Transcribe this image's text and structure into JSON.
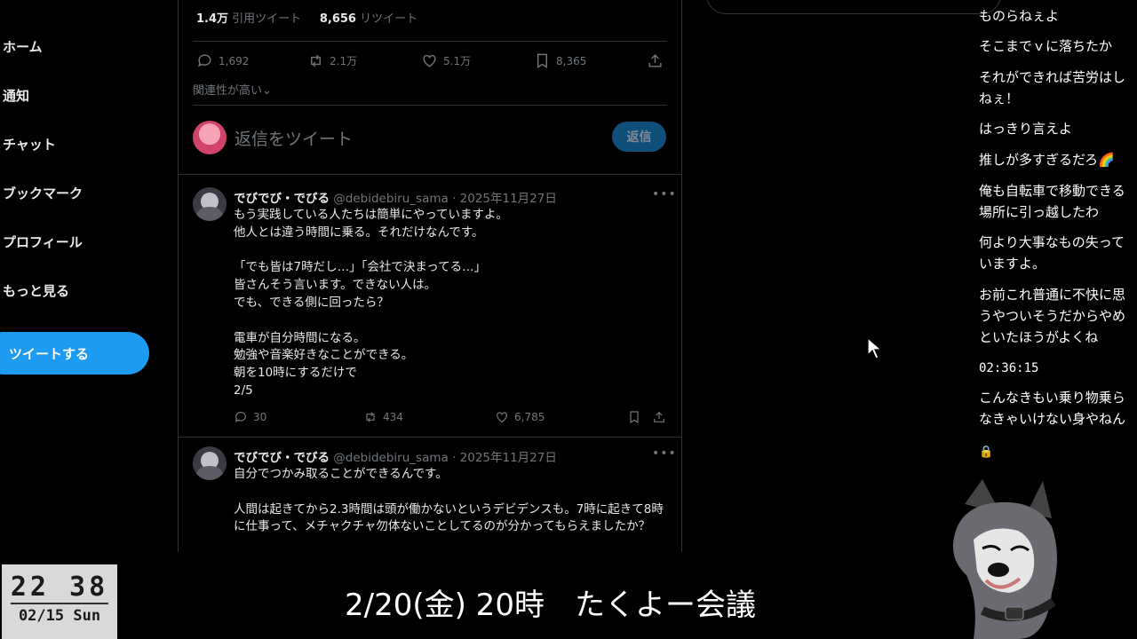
{
  "nav": {
    "items": [
      "ホーム",
      "通知",
      "チャット",
      "ブックマーク",
      "プロフィール",
      "もっと見る"
    ],
    "tweet_button": "ツイートする"
  },
  "top_stats": {
    "quotes_count": "1.4万",
    "quotes_label": "引用ツイート",
    "retweets_count": "8,656",
    "retweets_label": "リツイート"
  },
  "main_actions": {
    "replies": "1,692",
    "retweets": "2.1万",
    "likes": "5.1万",
    "bookmarks": "8,365"
  },
  "relevance_label": "関連性が高い",
  "reply_box": {
    "placeholder": "返信をツイート",
    "button": "返信"
  },
  "tweets": [
    {
      "name": "でびでび・でびる",
      "handle": "@debidebiru_sama · 2025年11月27日",
      "body": "もう実践している人たちは簡単にやっていますよ。\n他人とは違う時間に乗る。それだけなんです。\n\n「でも皆は7時だし…」「会社で決まってる…」\n皆さんそう言います。できない人は。\nでも、できる側に回ったら？\n\n電車が自分時間になる。\n勉強や音楽好きなことができる。\n朝を10時にするだけで\n2/5",
      "replies": "30",
      "retweets": "434",
      "likes": "6,785"
    },
    {
      "name": "でびでび・でびる",
      "handle": "@debidebiru_sama · 2025年11月27日",
      "body": "自分でつかみ取ることができるんです。\n\n人間は起きてから2.3時間は頭が働かないというデビデンスも。7時に起きて8時に仕事って、メチャクチャ勿体ないことしてるのが分かってもらえましたか？"
    }
  ],
  "chat_messages": [
    "ものらねぇよ",
    "そこまでｖに落ちたか",
    "それができれば苦労はしねぇ！",
    "はっきり言えよ",
    "推しが多すぎるだろ🌈",
    "俺も自転車で移動できる場所に引っ越したわ",
    "何より大事なもの失っていますよ。",
    "お前これ普通に不快に思うやつ​いそうだからやめといたほうがよくね",
    "02:36:15",
    "こんなきもい乗り物乗らなきゃいけない身やねん",
    "🔒"
  ],
  "clock": {
    "time": "22 38",
    "date": "02/15 Sun"
  },
  "caption": "2/20(金) 20時　たくよー会議",
  "colors": {
    "accent": "#1d9bf0",
    "background": "#000000",
    "muted": "#71767b"
  }
}
